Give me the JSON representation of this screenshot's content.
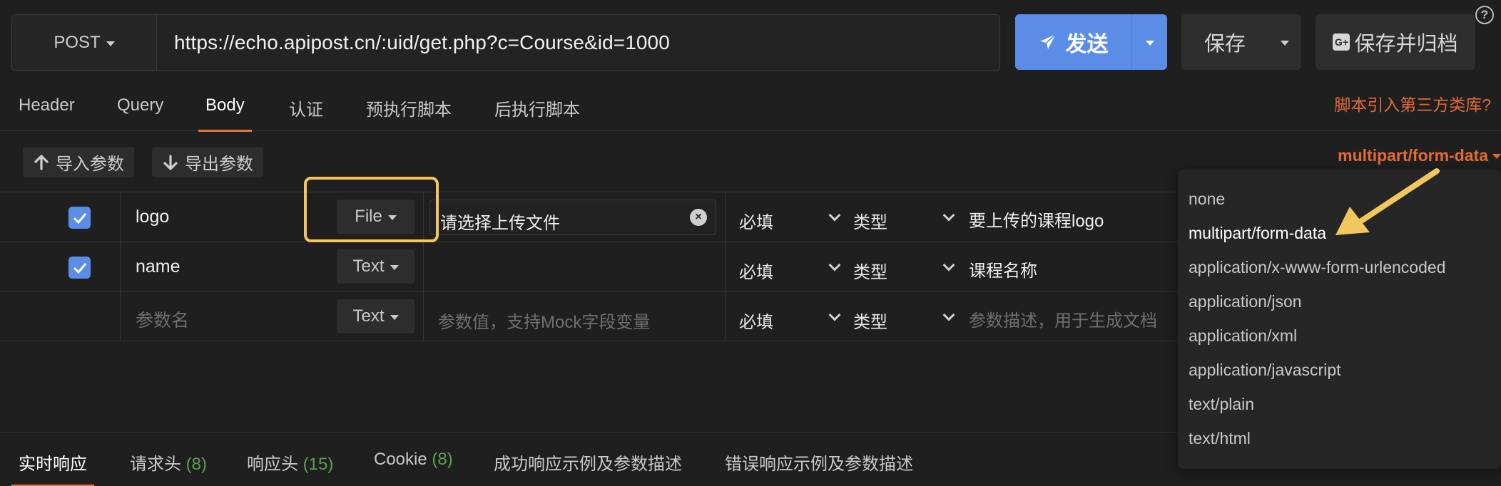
{
  "request": {
    "method": "POST",
    "url": "https://echo.apipost.cn/:uid/get.php?c=Course&id=1000",
    "send_label": "发送",
    "save_label": "保存",
    "save_archive_label": "保存并归档",
    "help_glyph": "?"
  },
  "tabs": [
    {
      "label": "Header"
    },
    {
      "label": "Query"
    },
    {
      "label": "Body"
    },
    {
      "label": "认证"
    },
    {
      "label": "预执行脚本"
    },
    {
      "label": "后执行脚本"
    }
  ],
  "active_tab": "Body",
  "third_party_link": "脚本引入第三方类库?",
  "toolbar": {
    "import_label": "导入参数",
    "export_label": "导出参数",
    "content_type": "multipart/form-data"
  },
  "params": [
    {
      "checked": true,
      "name": "logo",
      "type": "File",
      "value": "请选择上传文件",
      "required": "必填",
      "type_label": "类型",
      "description": "要上传的课程logo"
    },
    {
      "checked": true,
      "name": "name",
      "type": "Text",
      "value": "",
      "required": "必填",
      "type_label": "类型",
      "description": "课程名称"
    },
    {
      "checked": false,
      "name_placeholder": "参数名",
      "type": "Text",
      "value_placeholder": "参数值，支持Mock字段变量",
      "required": "必填",
      "type_label": "类型",
      "description_placeholder": "参数描述，用于生成文档"
    }
  ],
  "content_type_options": [
    "none",
    "multipart/form-data",
    "application/x-www-form-urlencoded",
    "application/json",
    "application/xml",
    "application/javascript",
    "text/plain",
    "text/html"
  ],
  "selected_content_type": "multipart/form-data",
  "response_tabs": [
    {
      "label": "实时响应",
      "count": ""
    },
    {
      "label": "请求头",
      "count": "(8)"
    },
    {
      "label": "响应头",
      "count": "(15)"
    },
    {
      "label": "Cookie",
      "count": "(8)"
    },
    {
      "label": "成功响应示例及参数描述",
      "count": ""
    },
    {
      "label": "错误响应示例及参数描述",
      "count": ""
    }
  ],
  "colors": {
    "accent": "#e3753c",
    "primary": "#5b8de6",
    "link": "#e36b34",
    "annotation": "#f4c65e",
    "count": "#5aa050"
  }
}
